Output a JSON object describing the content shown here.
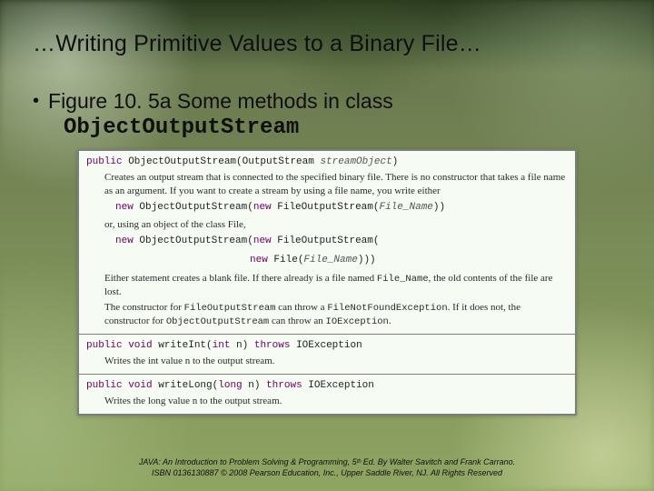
{
  "title": "…Writing Primitive Values to a Binary File…",
  "bullet": "Figure 10. 5a  Some methods in class",
  "classname": "ObjectOutputStream",
  "api": {
    "row1": {
      "sig_prefix": "public",
      "sig_body": " ObjectOutputStream(OutputStream ",
      "sig_arg": "streamObject",
      "sig_suffix": ")",
      "desc1": "Creates an output stream that is connected to the specified binary file. There is no constructor that takes a file name as an argument. If you want to create a stream by using a file name, you write either",
      "code1_kw": "new",
      "code1_a": " ObjectOutputStream(",
      "code1_kw2": "new",
      "code1_b": " FileOutputStream(",
      "code1_arg": "File_Name",
      "code1_c": "))",
      "desc2": "or, using an object of the class File,",
      "code2_kw": "new",
      "code2_a": " ObjectOutputStream(",
      "code2_kw2": "new",
      "code2_b": " FileOutputStream(",
      "code3_kw": "new",
      "code3_a": " File(",
      "code3_arg": "File_Name",
      "code3_b": ")))",
      "desc3a": "Either statement creates a blank file. If there already is a file named ",
      "desc3mono": "File_Name",
      "desc3b": ", the old contents of the file are lost.",
      "desc4a": "The constructor for ",
      "desc4m1": "FileOutputStream",
      "desc4b": " can throw a ",
      "desc4m2": "FileNotFoundException",
      "desc4c": ". If it does not, the constructor for ",
      "desc4m3": "ObjectOutputStream",
      "desc4d": " can throw an ",
      "desc4m4": "IOException",
      "desc4e": "."
    },
    "row2": {
      "sig_kw1": "public void",
      "sig_a": " writeInt(",
      "sig_kw2": "int",
      "sig_b": " n) ",
      "sig_kw3": "throws",
      "sig_c": " IOException",
      "desc": "Writes the int value n to the output stream."
    },
    "row3": {
      "sig_kw1": "public void",
      "sig_a": " writeLong(",
      "sig_kw2": "long",
      "sig_b": " n) ",
      "sig_kw3": "throws",
      "sig_c": " IOException",
      "desc": "Writes the long value n to the output stream."
    }
  },
  "footer1": "JAVA: An Introduction to Problem Solving & Programming, 5ᵗʰ Ed. By Walter Savitch and Frank Carrano.",
  "footer2": "ISBN 0136130887 © 2008 Pearson Education, Inc., Upper Saddle River, NJ. All Rights Reserved"
}
